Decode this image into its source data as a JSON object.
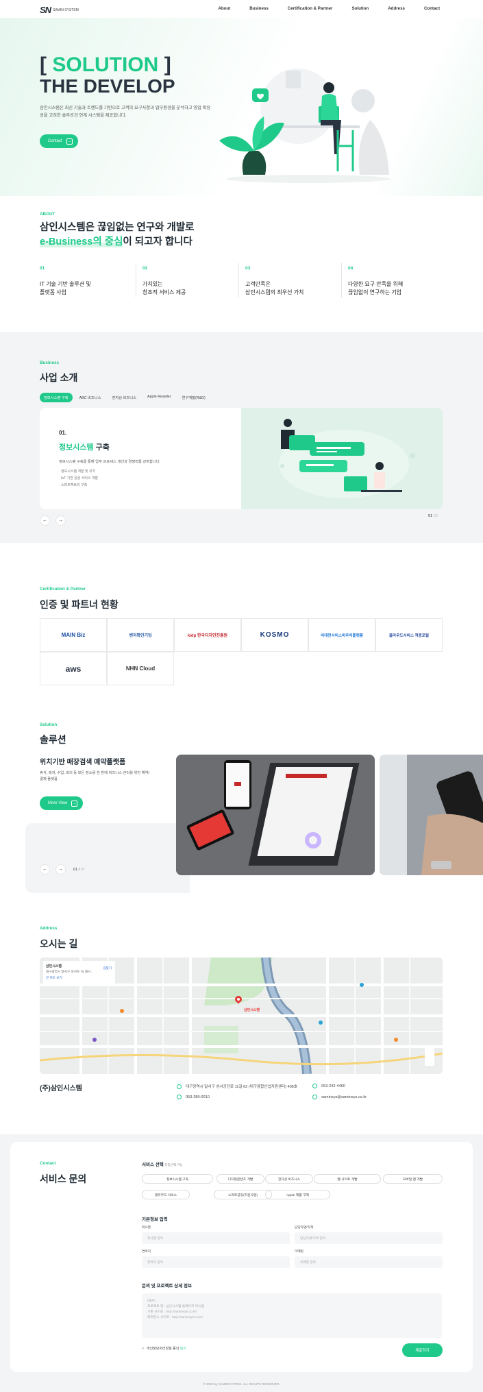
{
  "header": {
    "logo_mark": "SN",
    "logo_text": "SAMIN SYSTEM",
    "nav": [
      "About",
      "Business",
      "Certification & Partner",
      "Solution",
      "Address",
      "Contact"
    ]
  },
  "hero": {
    "bracket_open": "[",
    "title_green": "SOLUTION",
    "bracket_close": "]",
    "title2": "THE DEVELOP",
    "desc": "삼인시스템은 최신 기술과 트렌드를 기반으로 고객의 요구사항과 업무환경을 분석하고 영업 확장성을 고려한 솔루션과 연계 시스템을 제공합니다.",
    "button": "Contact",
    "button_icon": "arrow-right-square-icon"
  },
  "about": {
    "label": "ABOUT",
    "title_line1": "삼인시스템은 끊임없는 연구와 개발로",
    "title_hl": "e-Business의 중심",
    "title_rest": "이 되고자 합니다",
    "features": [
      {
        "num": "01",
        "text": "IT 기술 기반 솔루션 및\n플랫폼 사업"
      },
      {
        "num": "02",
        "text": "가치있는\n창조적 서비스 제공"
      },
      {
        "num": "03",
        "text": "고객만족은\n삼인시스템의 최우선 가치"
      },
      {
        "num": "04",
        "text": "다양한 요구 만족을 위해\n끊임없이 연구하는 기업"
      }
    ]
  },
  "business": {
    "label": "Business",
    "title": "사업 소개",
    "tabs": [
      "정보시스템 구축",
      "ABC 비즈니스",
      "전자상 비즈니스",
      "Apple Reseller",
      "연구개발(R&D)"
    ],
    "card": {
      "num": "01.",
      "title_green": "정보시스템",
      "title_rest": " 구축",
      "desc": "정보시스템 구축을 통해 업무 프로세스 개선과 경쟁력을 강화합니다.",
      "list": [
        "· 정보시스템 개발 및 유지",
        "· IoT 기반 응용 서비스 개발",
        "· 스마트팩토리 구축"
      ]
    },
    "prev": "←",
    "next": "→",
    "counter_current": "01",
    "counter_total": "05"
  },
  "cert": {
    "label": "Certification & Partner",
    "title": "인증 및 파트너 현황",
    "logos": [
      "MAIN Biz",
      "벤처확인기업",
      "kidp 한국디자인진흥원",
      "KOSMO",
      "비대면서비스바우처플랫폼",
      "클라우드서비스 적용포털",
      "aws",
      "NHN Cloud"
    ]
  },
  "solution": {
    "label": "Solution",
    "title": "솔루션",
    "subtitle": "위치기반 매장검색 예약플랫폼",
    "desc": "휴식, 레저, 수업, 회의 등 모든 장소를 한 번에 비즈니스 관리를 위한 예약/결제 플랫폼",
    "button": "More View",
    "prev": "←",
    "next": "→",
    "counter_current": "01",
    "counter_total": "07"
  },
  "address": {
    "label": "Address",
    "title": "오시는 길",
    "map_box_title": "삼인시스템",
    "map_box_addr": "대구광역시 달서구 성서로 79 대구...",
    "map_box_link": "큰 지도 보기",
    "map_box_dir": "길찾기",
    "map_pin_label": "삼인시스템",
    "company": "(주)삼인시스템",
    "addr": "대구광역시 달서구 성서공단로 11길 62 (대구융합산업지원센터) 405호",
    "fax": "053-289-0010",
    "tel": "053-242-4460",
    "email": "saminsys@saminsys.co.kr"
  },
  "contact": {
    "label": "Contact",
    "title": "서비스 문의",
    "service_title": "서비스 선택",
    "service_note": "다중선택 가능",
    "chips": [
      "정보시스템 구축",
      "디지털콘텐츠 개발",
      "전자상 비즈니스",
      "웹 사이트 개발",
      "모바일 앱 개발",
      "클라우드 서비스",
      "스마트공장(지원사업)",
      "Apple 제품 구매"
    ],
    "basic_title": "기본정보 입력",
    "fields": [
      {
        "label": "회사명",
        "placeholder": "회사명 입력"
      },
      {
        "label": "담당자명/직책",
        "placeholder": "담당자명/직책 입력"
      },
      {
        "label": "연락처",
        "placeholder": "연락처 입력"
      },
      {
        "label": "이메일",
        "placeholder": "이메일 입력"
      }
    ],
    "detail_title": "문의 및 프로젝트 상세 정보",
    "detail_placeholder": "(예시)\n프로젝트 명 : 삼인시스템 홈페이지 리뉴얼\n기존 사이트 : http://saminsys.co.kr/\n레퍼런스 사이트 : http://saminsys.co.kr/",
    "agree_text": "개인정보처리방침 동의",
    "agree_link": "보기",
    "submit": "제출하기"
  },
  "footer": {
    "copyright": "© 2023 by SAMINSYSTEM. ALL RIGHTS RESERVED."
  }
}
